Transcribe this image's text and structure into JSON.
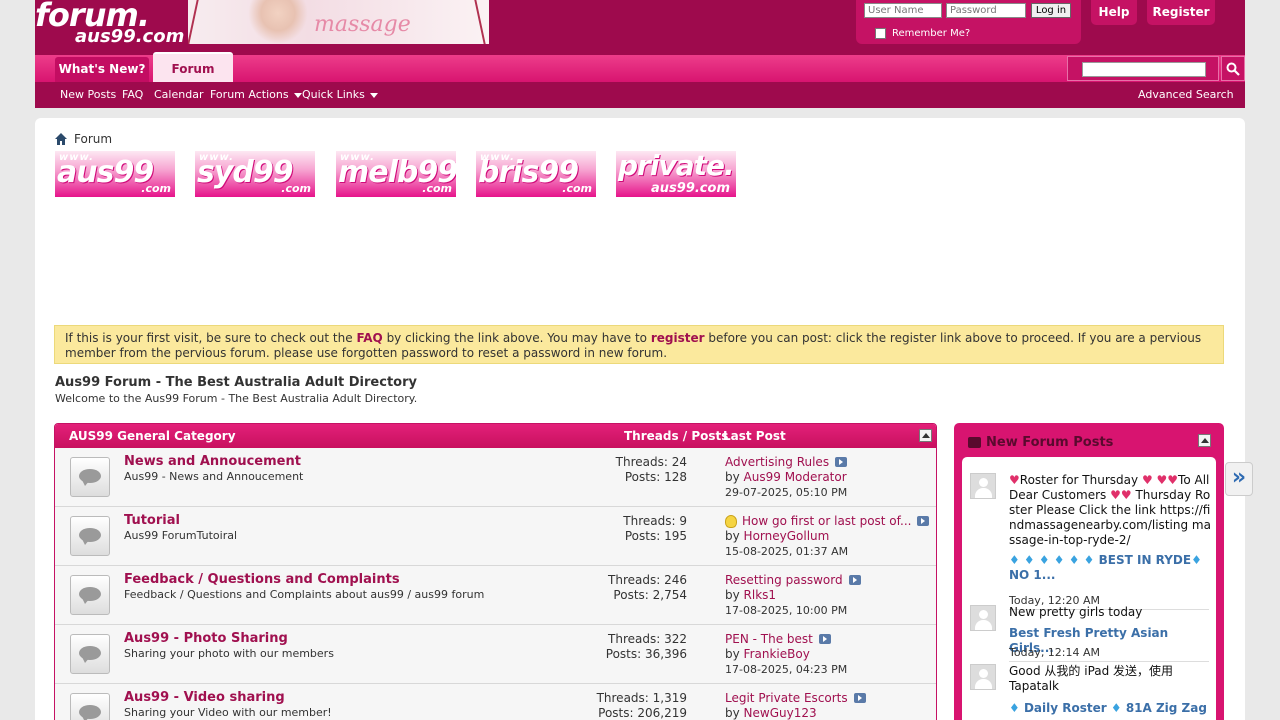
{
  "header": {
    "logo_line1": "forum.",
    "logo_line2": "aus99.com",
    "banner_text": "massage",
    "username_placeholder": "User Name",
    "password_placeholder": "Password",
    "login_label": "Log in",
    "remember_label": "Remember Me?",
    "help_label": "Help",
    "register_label": "Register"
  },
  "nav": {
    "tabs": [
      "What's New?",
      "Forum"
    ],
    "active_tab": "Forum",
    "subnav": [
      "New Posts",
      "FAQ",
      "Calendar",
      "Forum Actions",
      "Quick Links"
    ],
    "advanced_search": "Advanced Search"
  },
  "breadcrumb": {
    "label": "Forum"
  },
  "site_logos": [
    {
      "name": "aus99",
      "suffix": ".com"
    },
    {
      "name": "syd99",
      "suffix": ".com"
    },
    {
      "name": "melb99",
      "suffix": ".com"
    },
    {
      "name": "bris99",
      "suffix": ".com"
    },
    {
      "name": "private.",
      "suffix": "aus99.com"
    }
  ],
  "site_logo_prefix": "www.",
  "notice": {
    "t1": "If this is your first visit, be sure to check out the ",
    "faq": "FAQ",
    "t2": " by clicking the link above. You may have to ",
    "register": "register",
    "t3": " before you can post: click the register link above to proceed. If you are a pervious member from the pervious forum. please use forgotten password to reset a password in new forum."
  },
  "forum_title": "Aus99 Forum - The Best Australia Adult Directory",
  "forum_subtitle": "Welcome to the Aus99 Forum - The Best Australia Adult Directory.",
  "category": {
    "title": "AUS99 General Category",
    "threads_posts_header": "Threads / Posts",
    "last_post_header": "Last Post",
    "forums": [
      {
        "name": "News and Annoucement",
        "desc": "Aus99 - News and Annoucement",
        "threads": "Threads: 24",
        "posts": "Posts: 128",
        "lp_title": "Advertising Rules",
        "lp_by_label": "by ",
        "lp_user": "Aus99 Moderator",
        "lp_date": "29-07-2025, 05:10 PM"
      },
      {
        "name": "Tutorial",
        "desc": "Aus99 ForumTutoiral",
        "threads": "Threads: 9",
        "posts": "Posts: 195",
        "lp_title": "How go first or last post of...",
        "lp_by_label": "by ",
        "lp_user": "HorneyGollum",
        "lp_date": "15-08-2025, 01:37 AM"
      },
      {
        "name": "Feedback / Questions and Complaints",
        "desc": "Feedback / Questions and Complaints about aus99 / aus99 forum",
        "threads": "Threads: 246",
        "posts": "Posts: 2,754",
        "lp_title": "Resetting password",
        "lp_by_label": "by ",
        "lp_user": "Rlks1",
        "lp_date": "17-08-2025, 10:00 PM"
      },
      {
        "name": "Aus99 - Photo Sharing",
        "desc": "Sharing your photo with our members",
        "threads": "Threads: 322",
        "posts": "Posts: 36,396",
        "lp_title": "PEN - The best",
        "lp_by_label": "by ",
        "lp_user": "FrankieBoy",
        "lp_date": "17-08-2025, 04:23 PM"
      },
      {
        "name": "Aus99 - Video sharing",
        "desc": "Sharing your Video with our member!",
        "threads": "Threads: 1,319",
        "posts": "Posts: 206,219",
        "lp_title": "Legit Private Escorts",
        "lp_by_label": "by ",
        "lp_user": "NewGuy123",
        "lp_date": ""
      }
    ]
  },
  "sidebar": {
    "title": "New Forum Posts",
    "posts": [
      {
        "line1": "Roster for Thursday",
        "line2": "To All Dear Customers",
        "line3": "Thursday Roster Please Click the link https://findmassagenearby.com/listing massage-in-top-ryde-2/",
        "link": "BEST IN RYDE",
        "link2": "NO 1...",
        "date": "Today, 12:20 AM"
      },
      {
        "line1": "New pretty girls today",
        "link": "Best Fresh Pretty Asian Girls...",
        "date": "Today, 12:14 AM"
      },
      {
        "line1": "Good 从我的 iPad 发送，使用 Tapatalk",
        "link": "Daily Roster",
        "link2": "81A Zig Zag"
      }
    ]
  },
  "colors": {
    "brand": "#9e0a4d",
    "accent": "#d81470",
    "link": "#a0104f",
    "notice_bg": "#fbe99d"
  }
}
